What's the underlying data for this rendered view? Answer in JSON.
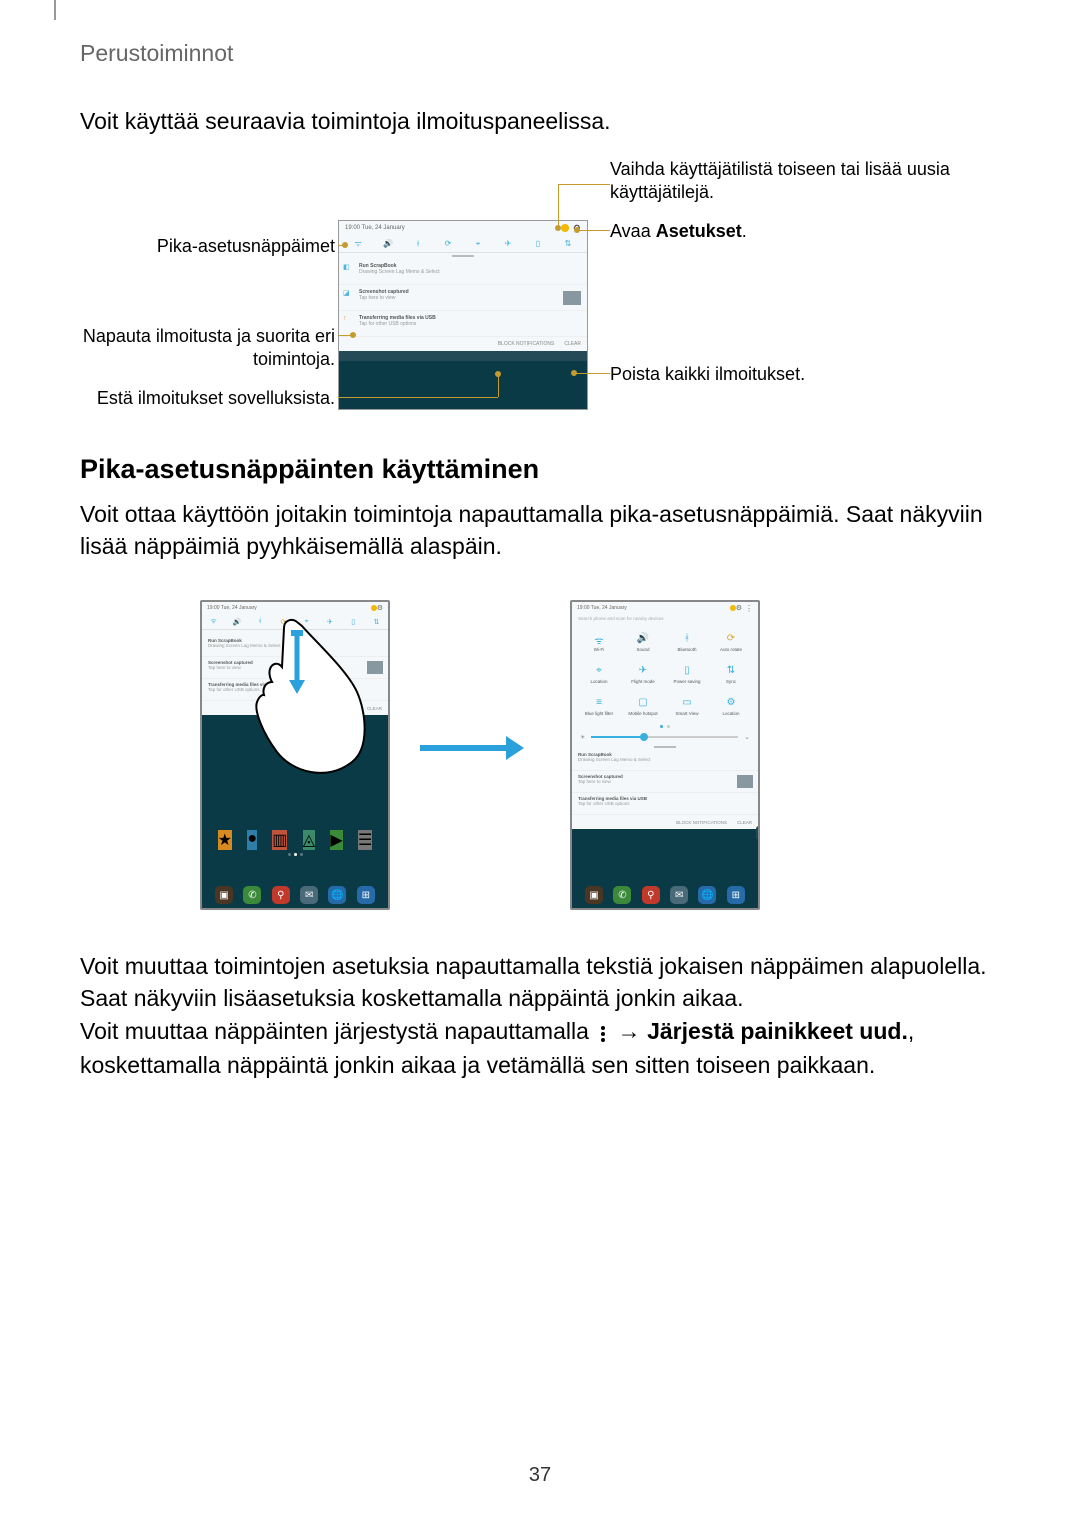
{
  "header": {
    "breadcrumb": "Perustoiminnot"
  },
  "intro": "Voit käyttää seuraavia toimintoja ilmoituspaneelissa.",
  "callouts": {
    "user_switch": "Vaihda käyttäjätilistä toiseen tai lisää uusia käyttäjätilejä.",
    "quick_settings": "Pika-asetusnäppäimet",
    "open_settings_prefix": "Avaa ",
    "open_settings_bold": "Asetukset",
    "open_settings_suffix": ".",
    "tap_notification": "Napauta ilmoitusta ja suorita eri toimintoja.",
    "block_notifications": "Estä ilmoitukset sovelluksista.",
    "clear_notifications": "Poista kaikki ilmoitukset."
  },
  "section_heading": "Pika-asetusnäppäinten käyttäminen",
  "para1": "Voit ottaa käyttöön joitakin toimintoja napauttamalla pika-asetusnäppäimiä. Saat näkyviin lisää näppäimiä pyyhkäisemällä alaspäin.",
  "para2": "Voit muuttaa toimintojen asetuksia napauttamalla tekstiä jokaisen näppäimen alapuolella. Saat näkyviin lisäasetuksia koskettamalla näppäintä jonkin aikaa.",
  "para3_a": "Voit muuttaa näppäinten järjestystä napauttamalla ",
  "para3_b": " → ",
  "para3_bold": "Järjestä painikkeet uud.",
  "para3_c": ", koskettamalla näppäintä jonkin aikaa ja vetämällä sen sitten toiseen paikkaan.",
  "status": {
    "time_date": "19:00   Tue, 24 January"
  },
  "quick_icons": [
    "wifi",
    "sound",
    "bt",
    "rotate",
    "location",
    "flight",
    "battery",
    "sync"
  ],
  "tiles": [
    {
      "icon": "wifi",
      "label": "Wi-Fi"
    },
    {
      "icon": "sound",
      "label": "Sound"
    },
    {
      "icon": "bt",
      "label": "Bluetooth"
    },
    {
      "icon": "rotate",
      "label": "Auto rotate"
    },
    {
      "icon": "location",
      "label": "Location"
    },
    {
      "icon": "flight",
      "label": "Flight mode"
    },
    {
      "icon": "battery",
      "label": "Power saving"
    },
    {
      "icon": "sync",
      "label": "Sync"
    },
    {
      "icon": "list",
      "label": "Blue light filter"
    },
    {
      "icon": "tablet",
      "label": "Mobile hotspot"
    },
    {
      "icon": "screen",
      "label": "Smart View"
    },
    {
      "icon": "gear",
      "label": "Location"
    }
  ],
  "dock_colors": [
    "#4a3622",
    "#3a8a3a",
    "#c0392b",
    "#4a6a7a",
    "#276aa8",
    "#276aa8"
  ],
  "bg_app_colors": [
    "#d68a1f",
    "#2f7ea8",
    "#c0533b",
    "#3a8a6a",
    "#3a8a3a",
    "#777"
  ],
  "page_number": "37"
}
